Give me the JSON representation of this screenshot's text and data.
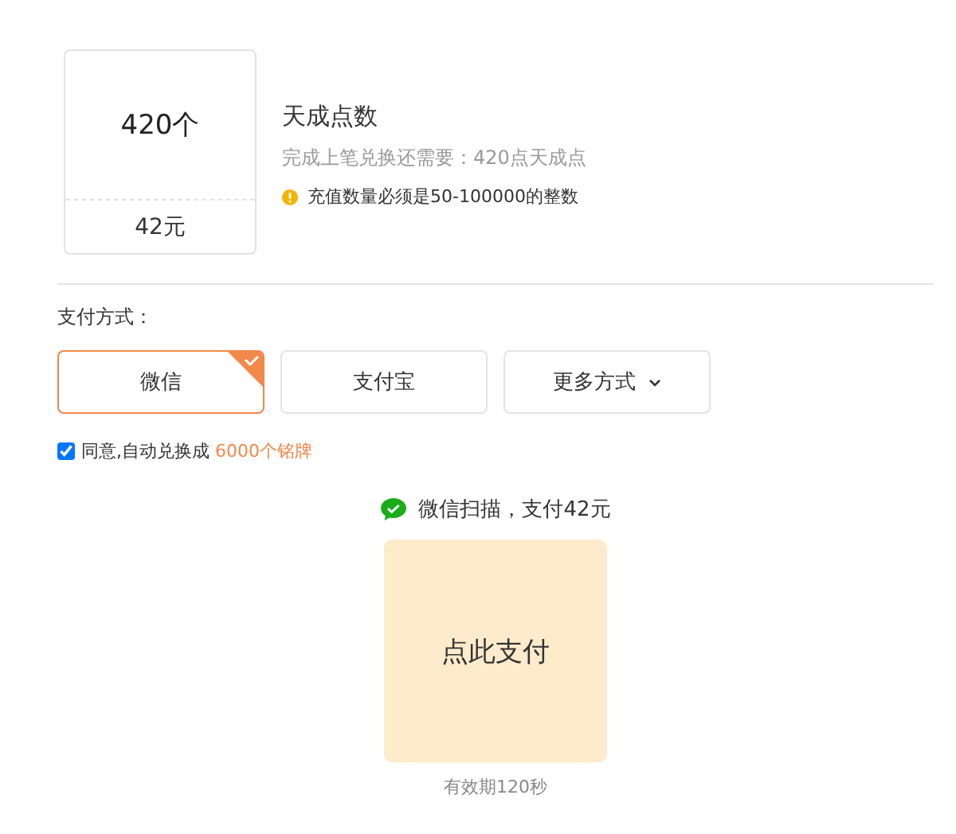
{
  "package": {
    "amount": "420个",
    "price": "42元"
  },
  "info": {
    "title": "天成点数",
    "requirement": "完成上笔兑换还需要：420点天成点",
    "warning": "充值数量必须是50-100000的整数"
  },
  "payment": {
    "label": "支付方式：",
    "methods": [
      {
        "label": "微信",
        "kind": "option",
        "selected": true
      },
      {
        "label": "支付宝",
        "kind": "option",
        "selected": false
      },
      {
        "label": "更多方式",
        "kind": "dropdown",
        "selected": false
      }
    ]
  },
  "agreement": {
    "checked": true,
    "text": "同意,自动兑换成",
    "highlight": "6000个铭牌"
  },
  "scan": {
    "title": "微信扫描，支付42元",
    "button": "点此支付",
    "expiry": "有效期120秒"
  }
}
